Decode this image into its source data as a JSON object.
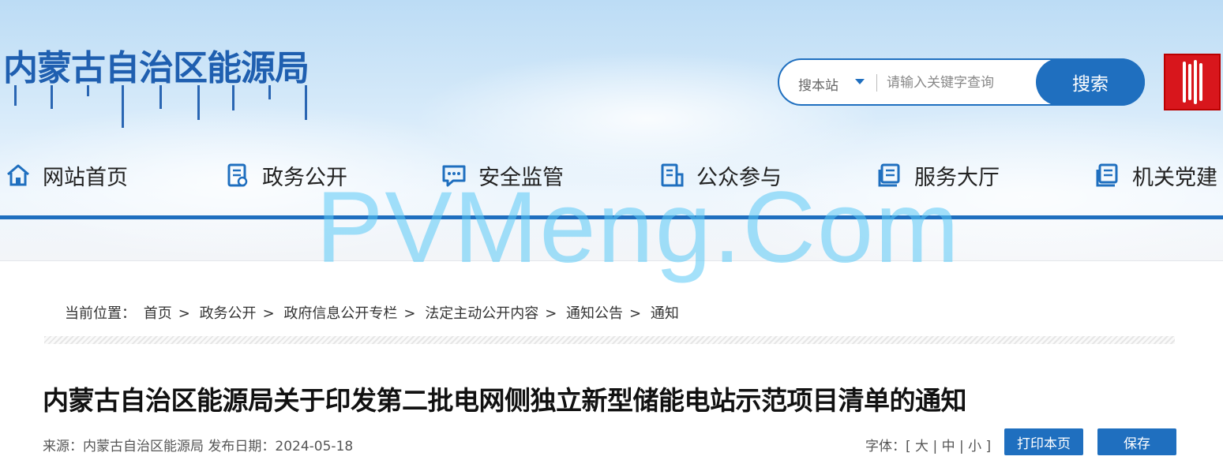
{
  "header": {
    "site_title": "内蒙古自治区能源局",
    "logo_name": "seal-logo"
  },
  "search": {
    "scope_label": "搜本站",
    "placeholder": "请输入关键字查询",
    "button_label": "搜索"
  },
  "nav": {
    "items": [
      {
        "label": "网站首页",
        "icon": "home-icon"
      },
      {
        "label": "政务公开",
        "icon": "document-icon"
      },
      {
        "label": "安全监管",
        "icon": "chat-bubble-icon"
      },
      {
        "label": "公众参与",
        "icon": "clipboard-icon"
      },
      {
        "label": "服务大厅",
        "icon": "service-book-icon"
      },
      {
        "label": "机关党建",
        "icon": "party-book-icon"
      }
    ]
  },
  "watermark": "PVMeng.Com",
  "breadcrumb": {
    "prefix": "当前位置：",
    "items": [
      "首页",
      "政务公开",
      "政府信息公开专栏",
      "法定主动公开内容",
      "通知公告",
      "通知"
    ],
    "separator": ">"
  },
  "article": {
    "title": "内蒙古自治区能源局关于印发第二批电网侧独立新型储能电站示范项目清单的通知",
    "source_label": "来源：",
    "source": "内蒙古自治区能源局",
    "date_label": "发布日期：",
    "date": "2024-05-18"
  },
  "toolbar": {
    "font_label": "字体：",
    "font_large": "大",
    "font_medium": "中",
    "font_small": "小",
    "print_label": "打印本页",
    "save_label": "保存"
  },
  "colors": {
    "brand_blue": "#1f6fbf",
    "title_blue": "#1f5fb0",
    "seal_red": "#d8161c",
    "watermark_cyan": "#5ac8f5"
  }
}
